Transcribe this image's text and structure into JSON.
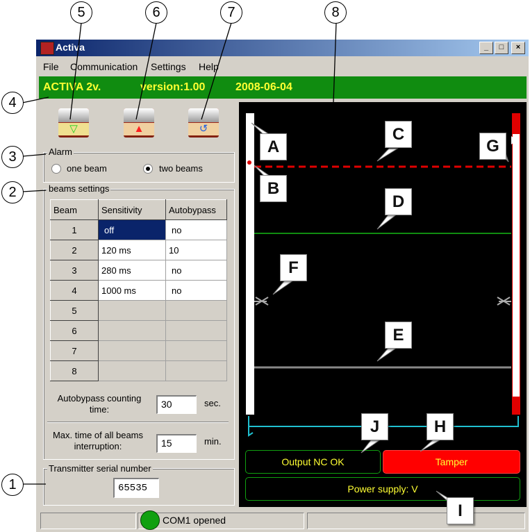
{
  "window": {
    "title": "Activa",
    "buttons": {
      "minimize": "_",
      "maximize": "□",
      "close": "×"
    }
  },
  "menu": [
    "File",
    "Communication",
    "Settings",
    "Help"
  ],
  "banner": {
    "model": "ACTIVA 2v.",
    "version": "version:1.00",
    "date": "2008-06-04"
  },
  "toolbar": [
    {
      "icon": "tools-green-down-icon",
      "symbol": "▽",
      "color": "#20c020"
    },
    {
      "icon": "tools-red-up-icon",
      "symbol": "▲",
      "color": "#e02020"
    },
    {
      "icon": "tools-refresh-icon",
      "symbol": "↺",
      "color": "#2060e0"
    }
  ],
  "alarm": {
    "title": "Alarm",
    "options": [
      "one beam",
      "two beams"
    ],
    "selected": "two beams"
  },
  "beams_settings": {
    "title": "beams settings",
    "columns": [
      "Beam",
      "Sensitivity",
      "Autobypass"
    ],
    "rows": [
      {
        "beam": "1",
        "sensitivity": "off",
        "autobypass": "no"
      },
      {
        "beam": "2",
        "sensitivity": "120 ms",
        "autobypass": "10"
      },
      {
        "beam": "3",
        "sensitivity": "280 ms",
        "autobypass": "no"
      },
      {
        "beam": "4",
        "sensitivity": "1000 ms",
        "autobypass": "no"
      },
      {
        "beam": "5",
        "sensitivity": "",
        "autobypass": ""
      },
      {
        "beam": "6",
        "sensitivity": "",
        "autobypass": ""
      },
      {
        "beam": "7",
        "sensitivity": "",
        "autobypass": ""
      },
      {
        "beam": "8",
        "sensitivity": "",
        "autobypass": ""
      }
    ]
  },
  "autobypass_time": {
    "label_line1": "Autobypass counting",
    "label_line2": "time:",
    "value": "30",
    "unit": "sec."
  },
  "max_time": {
    "label_line1": "Max. time of all beams",
    "label_line2": "interruption:",
    "value": "15",
    "unit": "min."
  },
  "transmitter": {
    "label": "Transmitter serial number",
    "value": "65535"
  },
  "beam_ticks": [
    "4",
    "3",
    "2",
    "1"
  ],
  "status": {
    "output": "Output NC OK",
    "tamper": "Tamper",
    "power": "Power supply: V",
    "tamper_color": "#ff0000",
    "ok_color": "#ffff33"
  },
  "statusbar": {
    "com": "COM1 opened",
    "indicator_color": "#10a010"
  },
  "callouts": {
    "numbers": [
      "1",
      "2",
      "3",
      "4",
      "5",
      "6",
      "7",
      "8"
    ],
    "letters": [
      "A",
      "B",
      "C",
      "D",
      "E",
      "F",
      "G",
      "H",
      "I",
      "J"
    ]
  }
}
